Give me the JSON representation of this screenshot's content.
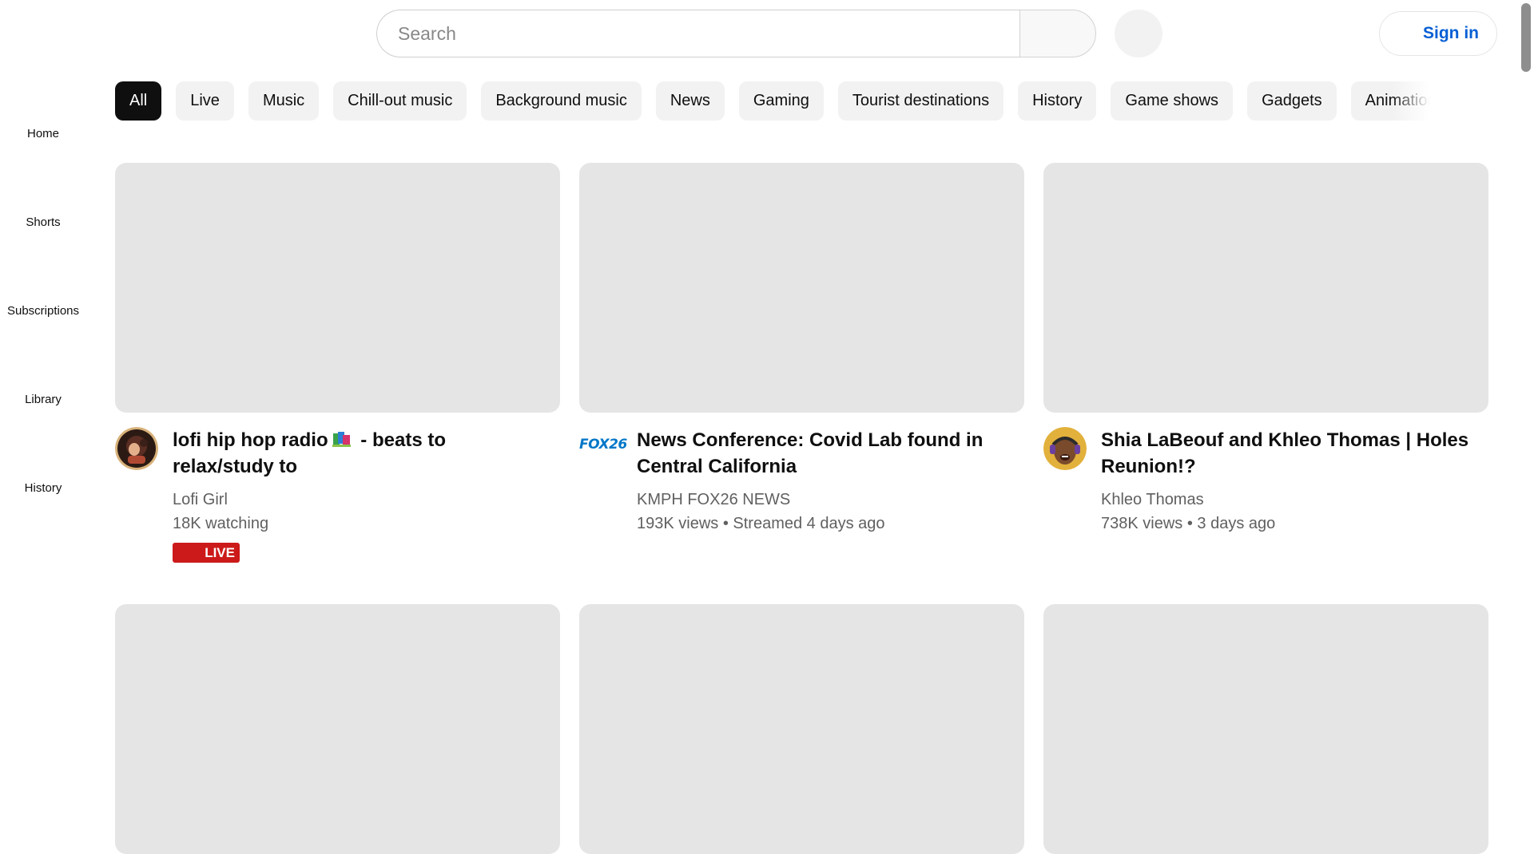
{
  "header": {
    "search_placeholder": "Search",
    "sign_in_label": "Sign in",
    "icons": [
      "search-icon",
      "microphone-icon",
      "account-circle-icon"
    ]
  },
  "chips": [
    {
      "label": "All",
      "active": true
    },
    {
      "label": "Live"
    },
    {
      "label": "Music"
    },
    {
      "label": "Chill-out music"
    },
    {
      "label": "Background music"
    },
    {
      "label": "News"
    },
    {
      "label": "Gaming"
    },
    {
      "label": "Tourist destinations"
    },
    {
      "label": "History"
    },
    {
      "label": "Game shows"
    },
    {
      "label": "Gadgets"
    },
    {
      "label": "Animation"
    }
  ],
  "sidebar": {
    "items": [
      {
        "label": "Home",
        "icon": "home-icon"
      },
      {
        "label": "Shorts",
        "icon": "shorts-icon"
      },
      {
        "label": "Subscriptions",
        "icon": "subscriptions-icon"
      },
      {
        "label": "Library",
        "icon": "library-icon"
      },
      {
        "label": "History",
        "icon": "history-icon"
      }
    ]
  },
  "videos": [
    {
      "title_part1": "lofi hip hop radio",
      "title_part2": " - beats to relax/study to",
      "channel": "Lofi Girl",
      "meta": "18K watching",
      "badge": "LIVE"
    },
    {
      "title": "News Conference: Covid Lab found in Central California",
      "channel": "KMPH FOX26 NEWS",
      "channel_logo": "FOX26",
      "meta": "193K views • Streamed 4 days ago"
    },
    {
      "title": "Shia LaBeouf and Khleo Thomas | Holes Reunion!?",
      "channel": "Khleo Thomas",
      "meta": "738K views • 3 days ago"
    }
  ],
  "colors": {
    "accent_blue": "#065fd4",
    "live_red": "#cc1a1a",
    "chip_bg": "#f2f2f2",
    "thumb_placeholder": "#e5e5e5"
  }
}
